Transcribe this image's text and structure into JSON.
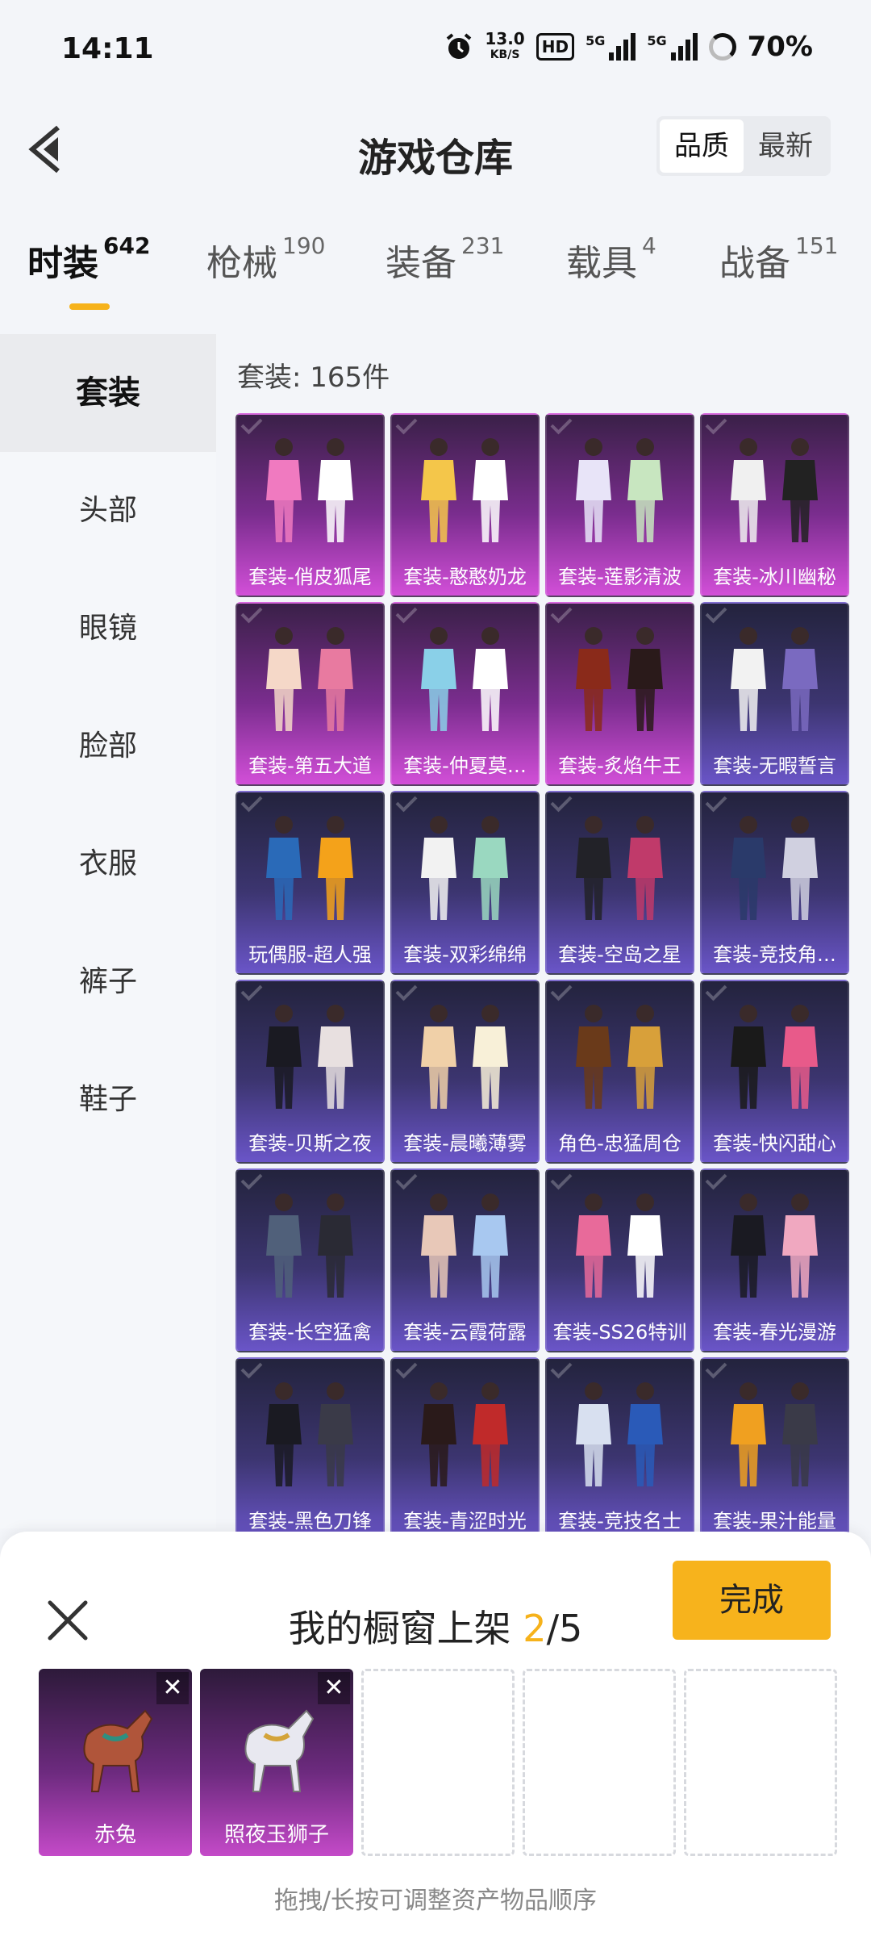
{
  "status_bar": {
    "time": "14:11",
    "net_speed": "13.0",
    "net_unit": "KB/S",
    "hd_label": "HD",
    "sim1": "5G",
    "sim2": "5G",
    "battery": "70%"
  },
  "header": {
    "title": "游戏仓库",
    "sort_options": [
      "品质",
      "最新"
    ],
    "sort_selected": "品质"
  },
  "tabs": [
    {
      "label": "时装",
      "count": "642",
      "active": true
    },
    {
      "label": "枪械",
      "count": "190",
      "active": false
    },
    {
      "label": "装备",
      "count": "231",
      "active": false
    },
    {
      "label": "载具",
      "count": "4",
      "active": false
    },
    {
      "label": "战备",
      "count": "151",
      "active": false
    }
  ],
  "sidebar": {
    "items": [
      "套装",
      "头部",
      "眼镜",
      "脸部",
      "衣服",
      "裤子",
      "鞋子"
    ],
    "active": "套装"
  },
  "main": {
    "count_prefix": "套装: ",
    "count_value": "165件"
  },
  "items": [
    {
      "name": "套装-俏皮狐尾",
      "tier": "pink"
    },
    {
      "name": "套装-憨憨奶龙",
      "tier": "pink"
    },
    {
      "name": "套装-莲影清波",
      "tier": "pink"
    },
    {
      "name": "套装-冰川幽秘",
      "tier": "pink"
    },
    {
      "name": "套装-第五大道",
      "tier": "pink"
    },
    {
      "name": "套装-仲夏莫…",
      "tier": "pink"
    },
    {
      "name": "套装-炙焰牛王",
      "tier": "pink"
    },
    {
      "name": "套装-无暇誓言",
      "tier": "purple"
    },
    {
      "name": "玩偶服-超人强",
      "tier": "purple"
    },
    {
      "name": "套装-双彩绵绵",
      "tier": "purple"
    },
    {
      "name": "套装-空岛之星",
      "tier": "purple"
    },
    {
      "name": "套装-竞技角…",
      "tier": "purple"
    },
    {
      "name": "套装-贝斯之夜",
      "tier": "purple"
    },
    {
      "name": "套装-晨曦薄雾",
      "tier": "purple"
    },
    {
      "name": "角色-忠猛周仓",
      "tier": "purple"
    },
    {
      "name": "套装-快闪甜心",
      "tier": "purple"
    },
    {
      "name": "套装-长空猛禽",
      "tier": "purple"
    },
    {
      "name": "套装-云霞荷露",
      "tier": "purple"
    },
    {
      "name": "套装-SS26特训",
      "tier": "purple"
    },
    {
      "name": "套装-春光漫游",
      "tier": "purple"
    },
    {
      "name": "套装-黑色刀锋",
      "tier": "purple"
    },
    {
      "name": "套装-青涩时光",
      "tier": "purple"
    },
    {
      "name": "套装-竞技名士",
      "tier": "purple"
    },
    {
      "name": "套装-果汁能量",
      "tier": "purple"
    }
  ],
  "panel": {
    "title_prefix": "我的橱窗上架 ",
    "selected_count": "2",
    "title_suffix": "/5",
    "done_label": "完成",
    "slots": [
      {
        "name": "赤兔"
      },
      {
        "name": "照夜玉狮子"
      }
    ],
    "empty_slots": 3,
    "hint": "拖拽/长按可调整资产物品顺序"
  },
  "colors": {
    "accent": "#f6b21b",
    "tier_pink": "#c44ac8",
    "tier_purple": "#6a55c8"
  }
}
